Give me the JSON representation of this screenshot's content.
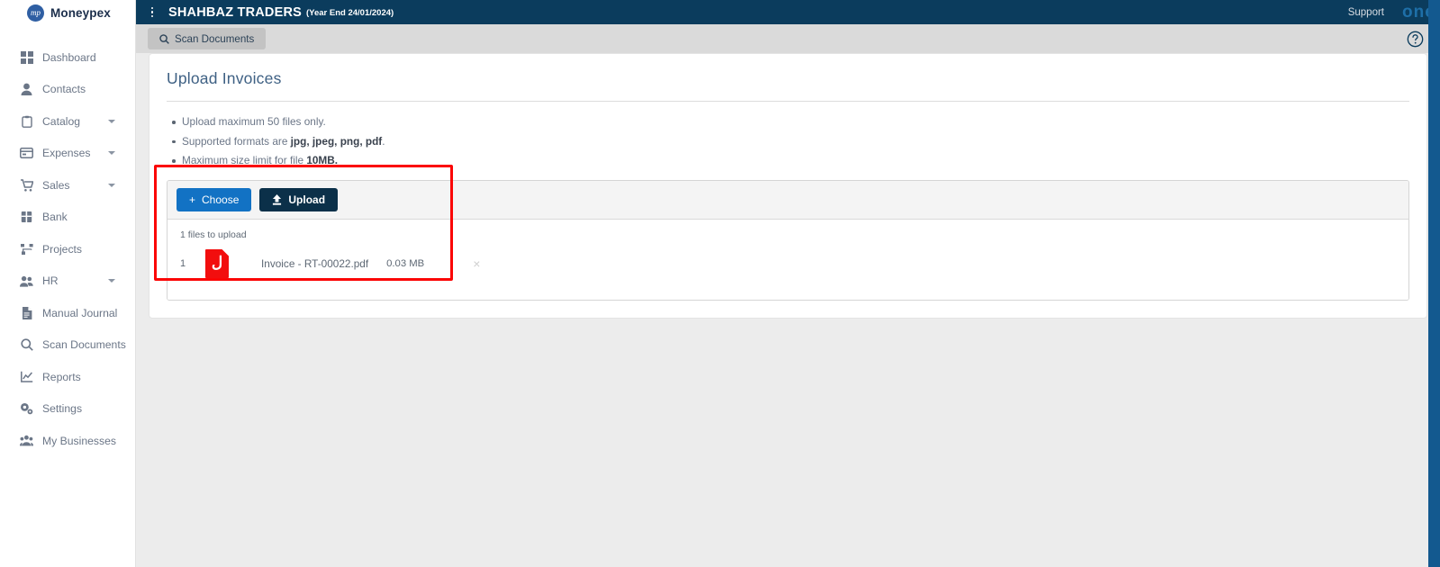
{
  "brand": {
    "name": "Moneypex",
    "mark": "mp"
  },
  "sidebar": {
    "items": [
      {
        "label": "Dashboard",
        "icon": "grid-icon",
        "caret": false
      },
      {
        "label": "Contacts",
        "icon": "user-icon",
        "caret": false
      },
      {
        "label": "Catalog",
        "icon": "clipboard-icon",
        "caret": true
      },
      {
        "label": "Expenses",
        "icon": "card-icon",
        "caret": true
      },
      {
        "label": "Sales",
        "icon": "cart-icon",
        "caret": true
      },
      {
        "label": "Bank",
        "icon": "bank-icon",
        "caret": false
      },
      {
        "label": "Projects",
        "icon": "sitemap-icon",
        "caret": false
      },
      {
        "label": "HR",
        "icon": "users-icon",
        "caret": true
      },
      {
        "label": "Manual Journal",
        "icon": "file-text-icon",
        "caret": false
      },
      {
        "label": "Scan Documents",
        "icon": "search-icon",
        "caret": false
      },
      {
        "label": "Reports",
        "icon": "chart-line-icon",
        "caret": false
      },
      {
        "label": "Settings",
        "icon": "gears-icon",
        "caret": false
      },
      {
        "label": "My Businesses",
        "icon": "people-group-icon",
        "caret": false
      }
    ]
  },
  "topbar": {
    "menu_icon": "kebab-menu-icon",
    "company": "SHAHBAZ TRADERS",
    "year_end": "(Year End 24/01/2024)",
    "support": "Support",
    "one_word": "one"
  },
  "toolbar": {
    "tab_label": "Scan Documents",
    "tab_icon": "search-icon",
    "help_icon": "question-circle-icon"
  },
  "page": {
    "title": "Upload Invoices",
    "notes": [
      {
        "pre": "Upload maximum 50 files only.",
        "bold": "",
        "post": ""
      },
      {
        "pre": "Supported formats are ",
        "bold": "jpg, jpeg, png, pdf",
        "post": "."
      },
      {
        "pre": "Maximum size limit for file ",
        "bold": "10MB.",
        "post": ""
      }
    ]
  },
  "uploader": {
    "choose_label": "Choose",
    "choose_glyph": "+",
    "upload_label": "Upload",
    "upload_glyph": "⬆",
    "files_count_text": "1 files to upload",
    "files": [
      {
        "index": "1",
        "icon": "pdf-file-icon",
        "name": "Invoice - RT-00022.pdf",
        "size": "0.03 MB",
        "remove": "×"
      }
    ]
  },
  "colors": {
    "navy": "#0b3c5d",
    "choose_blue": "#1272c4",
    "upload_navy": "#0b3049",
    "annotation_red": "#fb0505",
    "pdf_red": "#f20e0e",
    "workspace_gray": "#ececec",
    "toolbar_gray": "#dadada",
    "title_blue": "#3f6184",
    "scrollbar_blue": "#13598f"
  }
}
